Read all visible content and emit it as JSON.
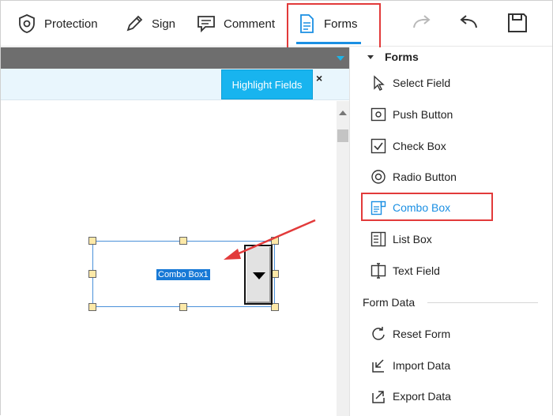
{
  "toolbar": {
    "protection_label": "Protection",
    "sign_label": "Sign",
    "comment_label": "Comment",
    "forms_label": "Forms",
    "icons": [
      "shield-icon",
      "pen-icon",
      "comment-icon",
      "document-icon",
      "redo-icon",
      "undo-icon",
      "save-icon"
    ],
    "active_tab": "Forms",
    "accent_color": "#1a8fe3",
    "annotation_color": "#e23a3a"
  },
  "highlight_bar": {
    "button_label": "Highlight Fields",
    "close_label": "×",
    "button_color": "#18b4ef"
  },
  "canvas": {
    "combo_field_text": "Combo Box1"
  },
  "panel": {
    "header": "Forms",
    "items": [
      {
        "label": "Select Field",
        "icon": "cursor-icon"
      },
      {
        "label": "Push Button",
        "icon": "push-button-icon"
      },
      {
        "label": "Check Box",
        "icon": "checkbox-icon"
      },
      {
        "label": "Radio Button",
        "icon": "radio-icon"
      },
      {
        "label": "Combo Box",
        "icon": "combo-box-icon",
        "active": true
      },
      {
        "label": "List Box",
        "icon": "list-box-icon"
      },
      {
        "label": "Text Field",
        "icon": "text-field-icon"
      }
    ],
    "section": "Form Data",
    "data_items": [
      {
        "label": "Reset Form",
        "icon": "reset-icon"
      },
      {
        "label": "Import Data",
        "icon": "import-icon"
      },
      {
        "label": "Export Data",
        "icon": "export-icon"
      }
    ]
  }
}
